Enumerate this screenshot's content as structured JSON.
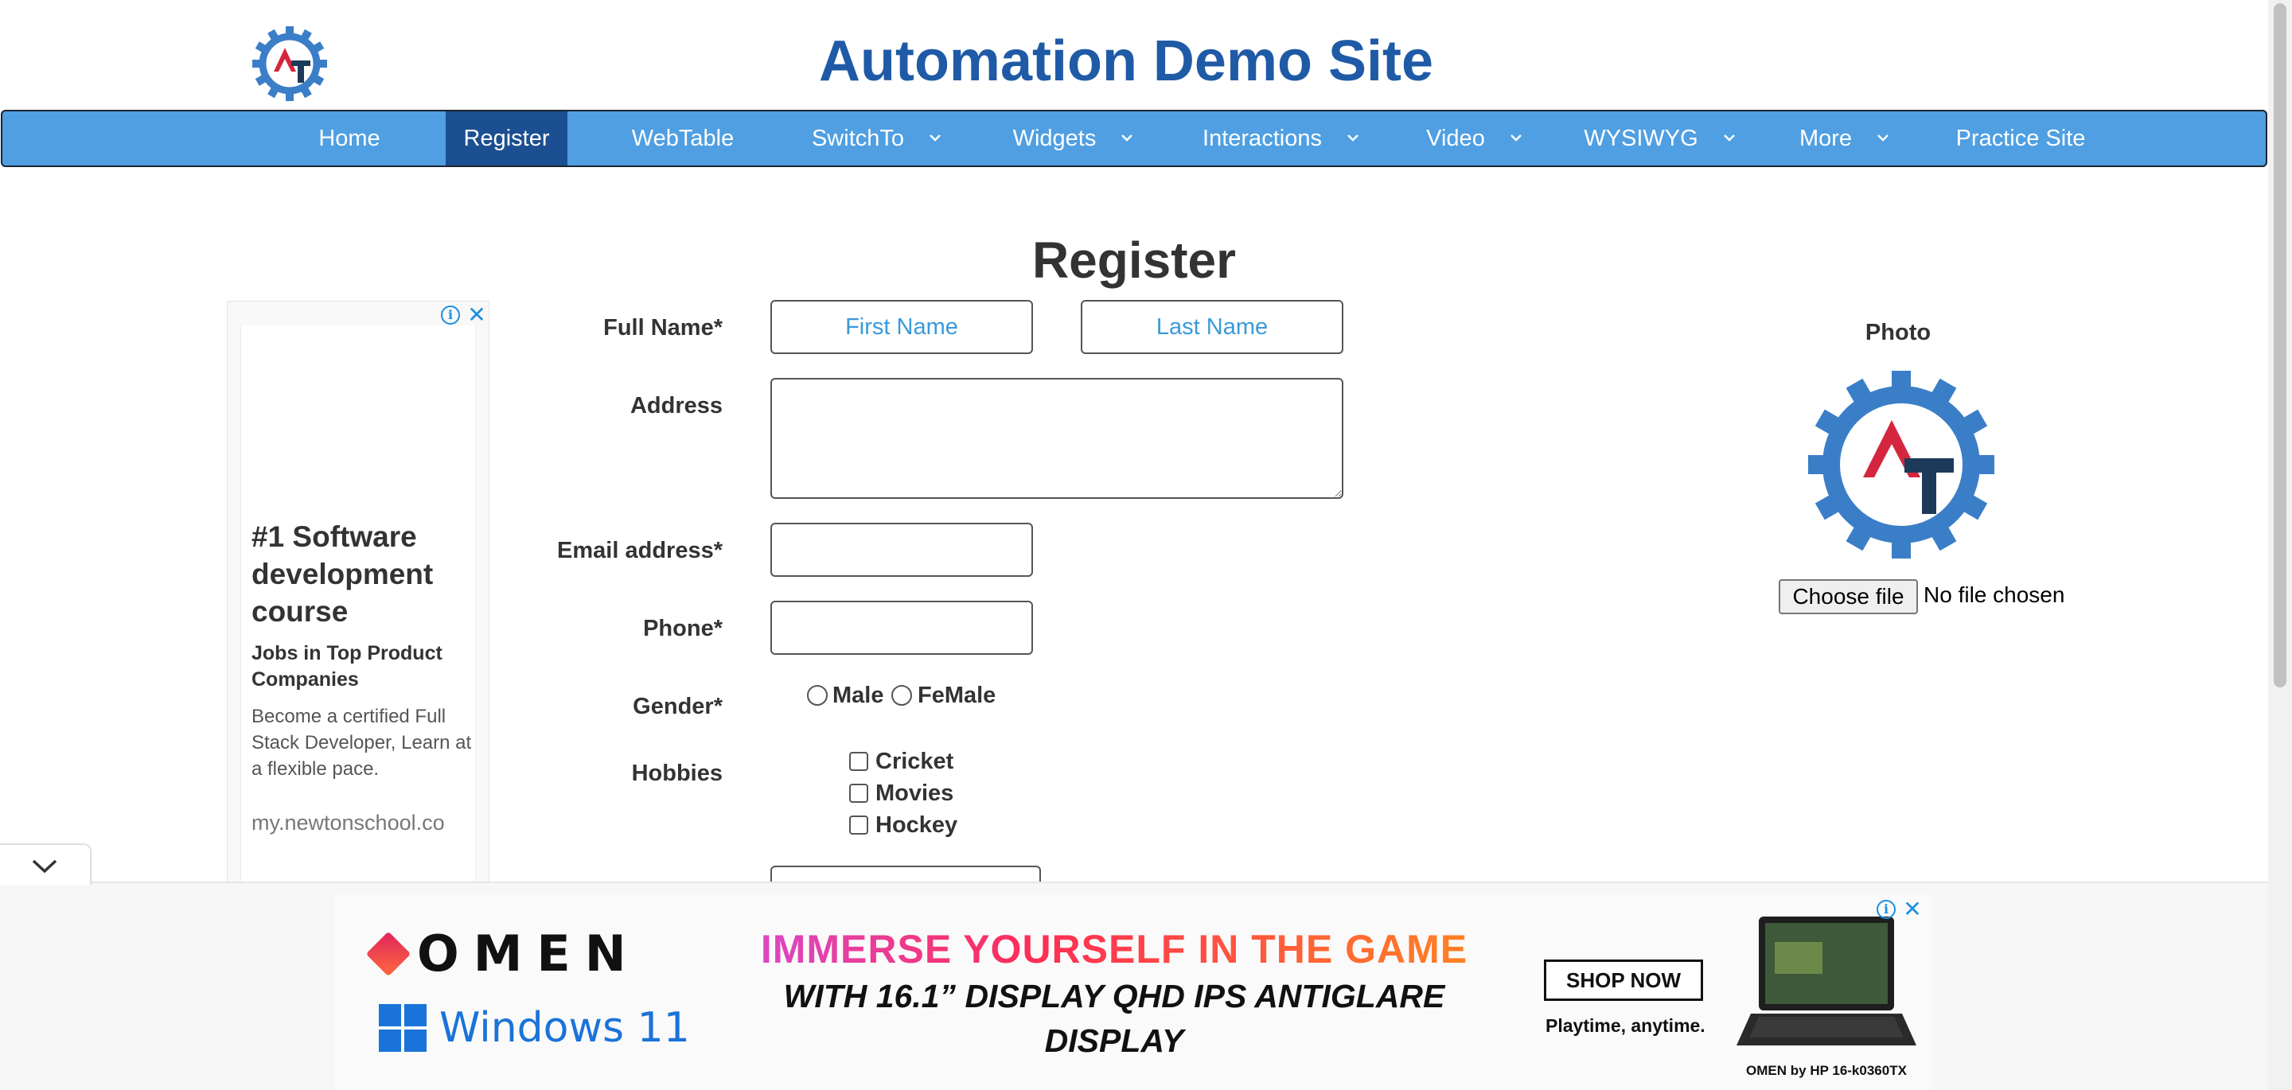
{
  "header": {
    "site_title": "Automation Demo Site"
  },
  "nav": {
    "items": [
      {
        "label": "Home",
        "has_dropdown": false,
        "active": false
      },
      {
        "label": "Register",
        "has_dropdown": false,
        "active": true
      },
      {
        "label": "WebTable",
        "has_dropdown": false,
        "active": false
      },
      {
        "label": "SwitchTo",
        "has_dropdown": true,
        "active": false
      },
      {
        "label": "Widgets",
        "has_dropdown": true,
        "active": false
      },
      {
        "label": "Interactions",
        "has_dropdown": true,
        "active": false
      },
      {
        "label": "Video",
        "has_dropdown": true,
        "active": false
      },
      {
        "label": "WYSIWYG",
        "has_dropdown": true,
        "active": false
      },
      {
        "label": "More",
        "has_dropdown": true,
        "active": false
      },
      {
        "label": "Practice Site",
        "has_dropdown": false,
        "active": false
      }
    ],
    "colors": {
      "bar": "#4f9fe2",
      "active": "#1c4f91"
    }
  },
  "page": {
    "heading": "Register"
  },
  "form": {
    "full_name_label": "Full Name*",
    "first_name_placeholder": "First Name",
    "last_name_placeholder": "Last Name",
    "address_label": "Address",
    "email_label": "Email address*",
    "phone_label": "Phone*",
    "gender_label": "Gender*",
    "gender_options": [
      "Male",
      "FeMale"
    ],
    "hobbies_label": "Hobbies",
    "hobbies_options": [
      "Cricket",
      "Movies",
      "Hockey"
    ]
  },
  "photo": {
    "label": "Photo",
    "choose_file_label": "Choose file",
    "file_status": "No file chosen"
  },
  "ad_left": {
    "headline": "#1 Software development course",
    "subheadline": "Jobs in Top Product Companies",
    "body": "Become a certified Full Stack Developer, Learn at a flexible pace.",
    "url": "my.newtonschool.co",
    "info_icon": "info-icon",
    "close_icon": "close-icon"
  },
  "ad_bottom": {
    "brand": "OMEN",
    "os_brand": "Windows 11",
    "slogan_line1": "IMMERSE YOURSELF IN THE GAME",
    "slogan_line2": "WITH 16.1” DISPLAY QHD IPS ANTIGLARE",
    "slogan_line3": "DISPLAY",
    "cta": "SHOP NOW",
    "tagline": "Playtime, anytime.",
    "product_caption": "OMEN by HP 16-k0360TX"
  }
}
